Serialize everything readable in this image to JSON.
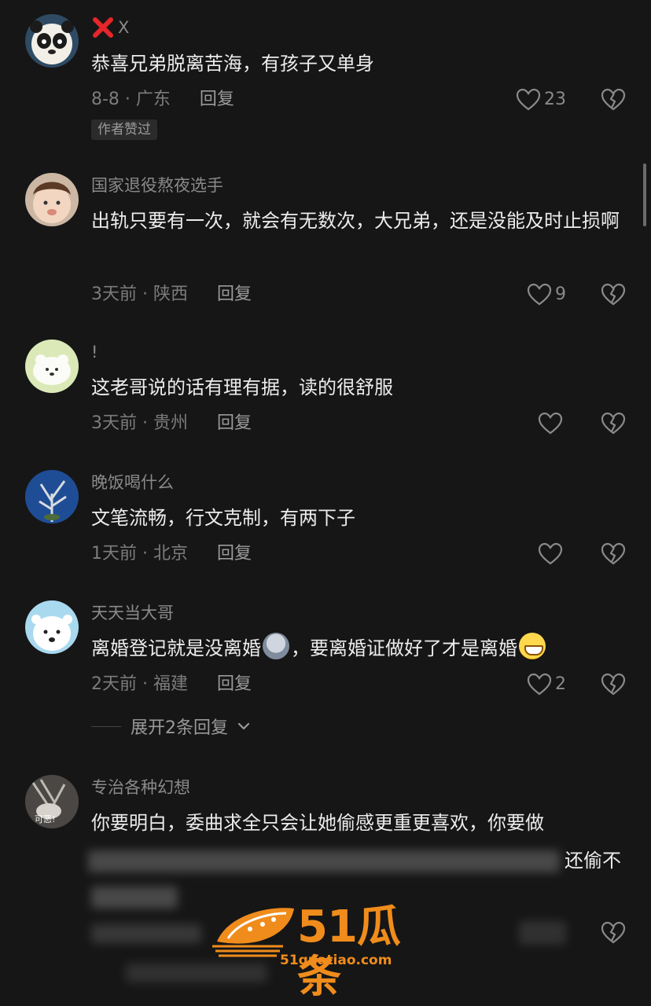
{
  "comments": [
    {
      "username": "X",
      "text": "恭喜兄弟脱离苦海，有孩子又单身",
      "meta": "8-8 · 广东",
      "reply_label": "回复",
      "likes": "23",
      "badge": "作者赞过"
    },
    {
      "username": "国家退役熬夜选手",
      "text": "出轨只要有一次，就会有无数次，大兄弟，还是没能及时止损啊",
      "meta": "3天前 · 陕西",
      "reply_label": "回复",
      "likes": "9"
    },
    {
      "username": "!",
      "text": "这老哥说的话有理有据，读的很舒服",
      "meta": "3天前 · 贵州",
      "reply_label": "回复",
      "likes": ""
    },
    {
      "username": "晚饭喝什么",
      "text": "文笔流畅，行文克制，有两下子",
      "meta": "1天前 · 北京",
      "reply_label": "回复",
      "likes": ""
    },
    {
      "username": "天天当大哥",
      "text_part1": "离婚登记就是没离婚",
      "text_part2": "，要离婚证做好了才是离婚",
      "meta": "2天前 · 福建",
      "reply_label": "回复",
      "likes": "2",
      "expand_label": "展开2条回复"
    },
    {
      "username": "专治各种幻想",
      "text_line1": "你要明白，委曲求全只会让她偷感更重更喜欢，你要做",
      "text_visible_tail": "还偷不",
      "avatar_caption": "可恶!"
    }
  ],
  "watermark": {
    "text": "51瓜条",
    "url": "51guatiao.com"
  },
  "colors": {
    "background": "#161616",
    "text": "#ececec",
    "muted": "#7c7c7c",
    "watermark": "#f08c1c",
    "x_mark": "#e5262b"
  }
}
